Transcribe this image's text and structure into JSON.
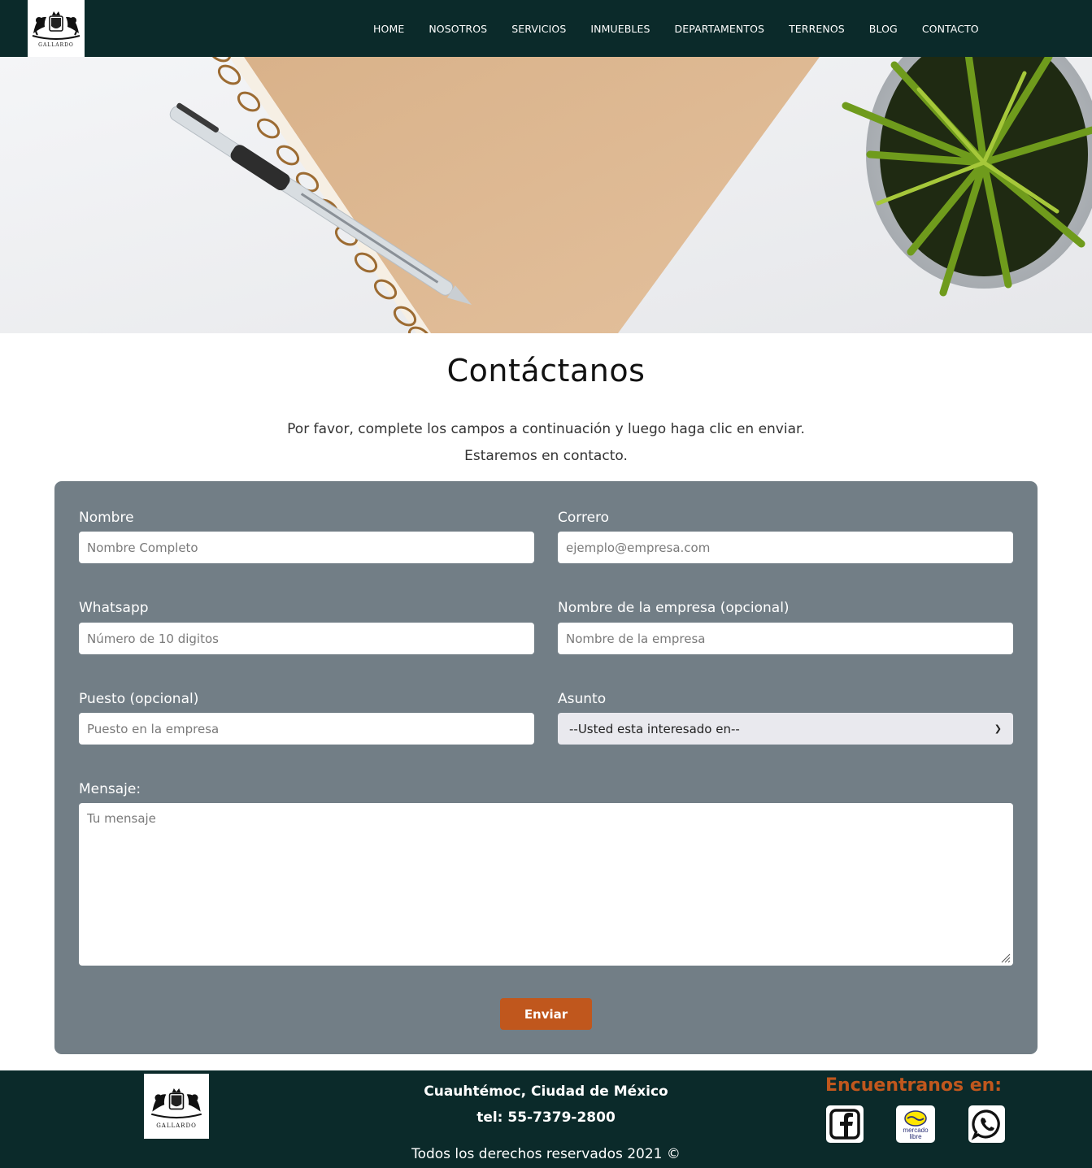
{
  "brand": {
    "logo_text": "GALLARDO"
  },
  "nav": {
    "items": [
      {
        "label": "HOME"
      },
      {
        "label": "NOSOTROS"
      },
      {
        "label": "SERVICIOS"
      },
      {
        "label": "INMUEBLES"
      },
      {
        "label": "DEPARTAMENTOS"
      },
      {
        "label": "TERRENOS"
      },
      {
        "label": "BLOG"
      },
      {
        "label": "CONTACTO"
      }
    ]
  },
  "page": {
    "title": "Contáctanos",
    "intro_line1": "Por favor, complete los campos a continuación y luego haga clic en enviar.",
    "intro_line2": "Estaremos en contacto."
  },
  "form": {
    "name": {
      "label": "Nombre",
      "placeholder": "Nombre Completo"
    },
    "email": {
      "label": "Correro",
      "placeholder": "ejemplo@empresa.com"
    },
    "whatsapp": {
      "label": "Whatsapp",
      "placeholder": "Número de 10 digitos"
    },
    "company": {
      "label": "Nombre de la empresa (opcional)",
      "placeholder": "Nombre de la empresa"
    },
    "position": {
      "label": "Puesto (opcional)",
      "placeholder": "Puesto en la empresa"
    },
    "subject": {
      "label": "Asunto",
      "selected": "--Usted esta interesado en--"
    },
    "message": {
      "label": "Mensaje:",
      "placeholder": "Tu mensaje"
    },
    "submit_label": "Enviar"
  },
  "footer": {
    "address": "Cuauhtémoc, Ciudad de México",
    "phone": "tel: 55-7379-2800",
    "copyright": "Todos los derechos reservados 2021 ©",
    "find_us": "Encuentranos en:",
    "social": [
      {
        "icon": "facebook-icon"
      },
      {
        "icon": "mercado-libre-icon",
        "text": "mercado libre"
      },
      {
        "icon": "whatsapp-icon"
      }
    ]
  },
  "colors": {
    "nav_bg": "#0b2a2a",
    "form_bg": "#727e86",
    "accent": "#c0571d"
  }
}
